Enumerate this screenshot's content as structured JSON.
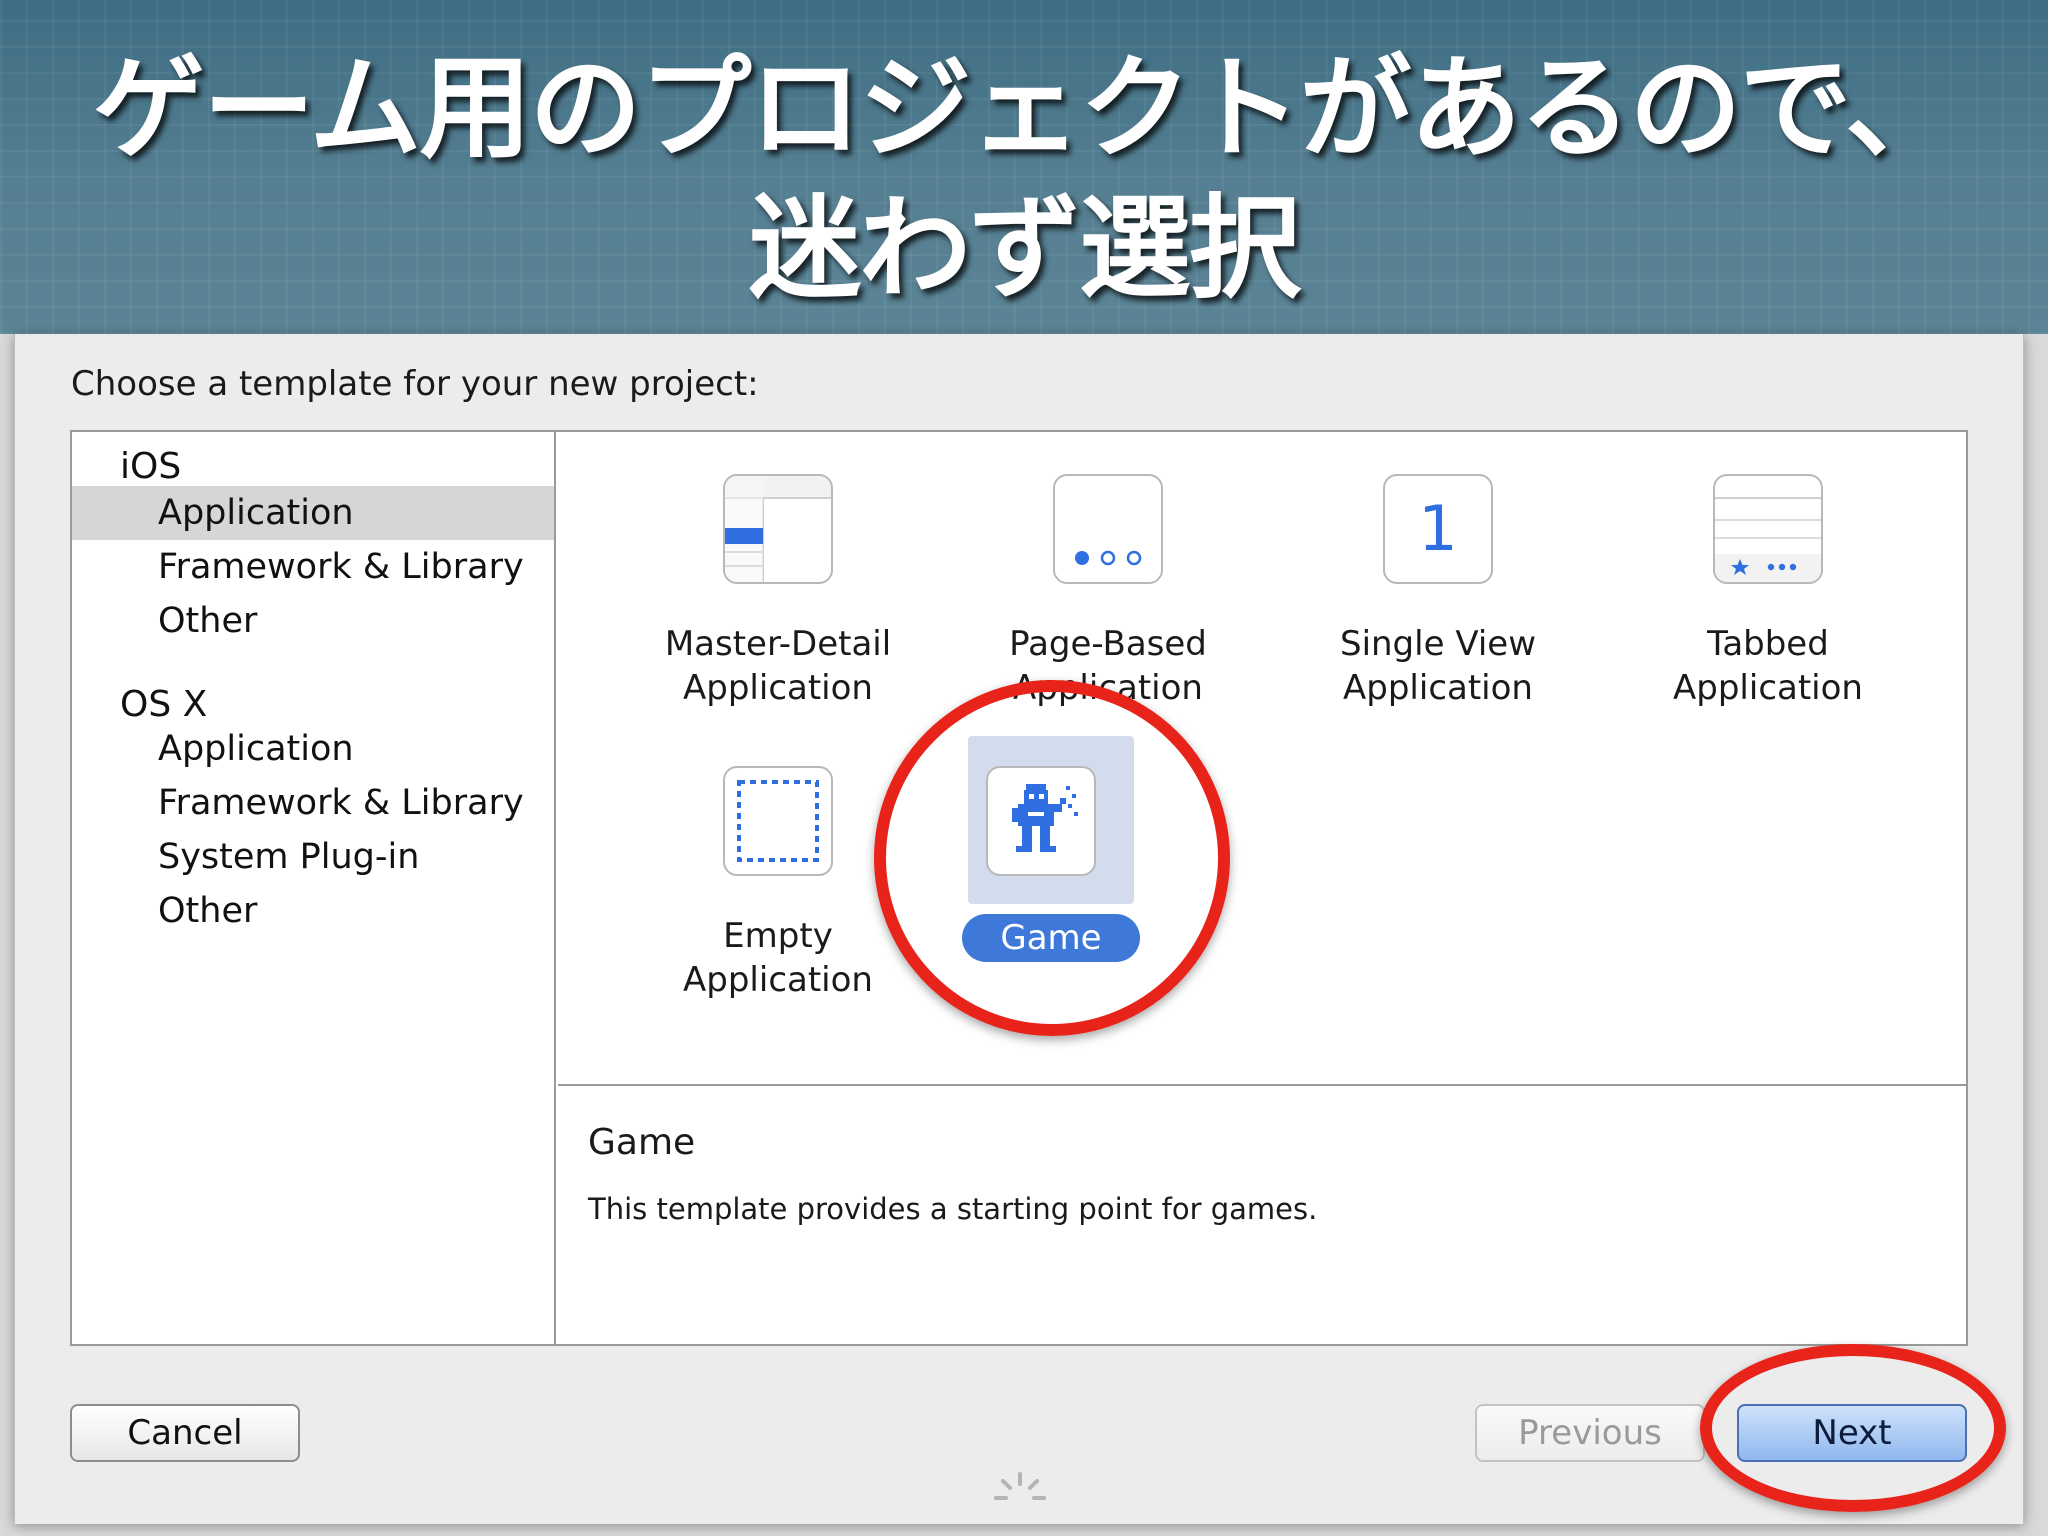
{
  "banner": {
    "line1": "ゲーム用のプロジェクトがあるので、",
    "line2": "迷わず選択"
  },
  "dialog": {
    "prompt": "Choose a template for your new project:",
    "sidebar": {
      "groups": [
        {
          "label": "iOS",
          "items": [
            {
              "label": "Application",
              "selected": true
            },
            {
              "label": "Framework & Library",
              "selected": false
            },
            {
              "label": "Other",
              "selected": false
            }
          ]
        },
        {
          "label": "OS X",
          "items": [
            {
              "label": "Application",
              "selected": false
            },
            {
              "label": "Framework & Library",
              "selected": false
            },
            {
              "label": "System Plug-in",
              "selected": false
            },
            {
              "label": "Other",
              "selected": false
            }
          ]
        }
      ]
    },
    "templates": [
      {
        "label": "Master-Detail\nApplication",
        "icon": "master-detail-icon",
        "selected": false
      },
      {
        "label": "Page-Based\nApplication",
        "icon": "page-based-icon",
        "selected": false
      },
      {
        "label": "Single View\nApplication",
        "icon": "single-view-icon",
        "icon_text": "1",
        "selected": false
      },
      {
        "label": "Tabbed\nApplication",
        "icon": "tabbed-icon",
        "selected": false
      },
      {
        "label": "Empty\nApplication",
        "icon": "empty-application-icon",
        "selected": false
      },
      {
        "label": "Game",
        "icon": "game-icon",
        "selected": true
      }
    ],
    "description": {
      "title": "Game",
      "text": "This template provides a starting point for games."
    },
    "buttons": {
      "cancel": "Cancel",
      "previous": "Previous",
      "next": "Next",
      "previous_enabled": false
    }
  },
  "colors": {
    "selection_blue": "#3e78d8",
    "selection_bg": "#d3dced",
    "annotation_red": "#e8231a",
    "icon_blue": "#2f6fe0"
  }
}
